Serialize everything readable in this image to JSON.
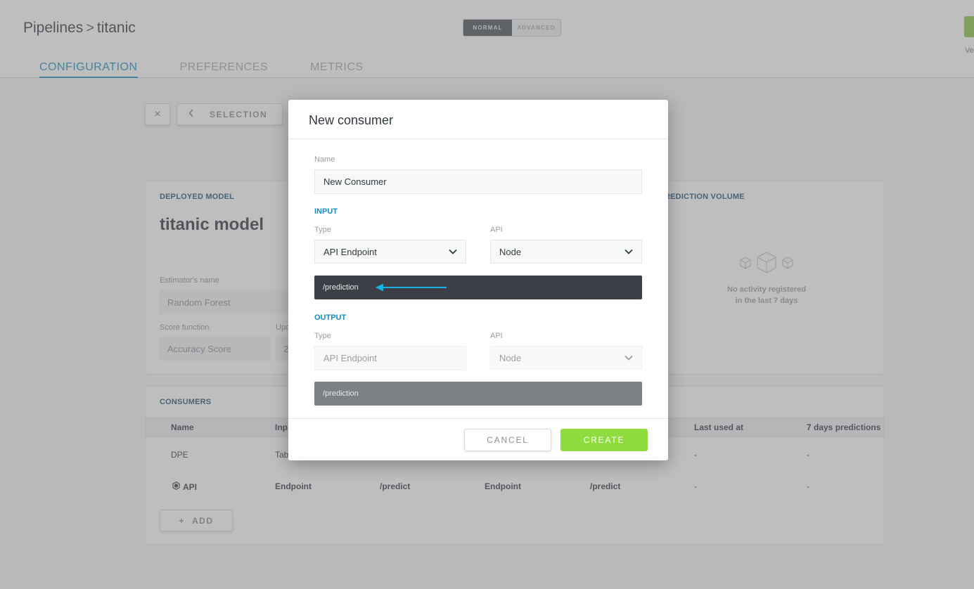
{
  "header": {
    "breadcrumb_root": "Pipelines",
    "breadcrumb_sep": ">",
    "breadcrumb_current": "titanic",
    "mode_normal": "NORMAL",
    "mode_advanced": "ADVANCED",
    "right_text": "Ve"
  },
  "tabs": [
    {
      "label": "CONFIGURATION",
      "active": true
    },
    {
      "label": "PREFERENCES",
      "active": false
    },
    {
      "label": "METRICS",
      "active": false
    }
  ],
  "toolbar": {
    "close_icon": "×",
    "back_icon": "‹",
    "selection_label": "SELECTION"
  },
  "deployed_model": {
    "section_title": "DEPLOYED MODEL",
    "model_name": "titanic model",
    "estimator_label": "Estimator's name",
    "estimator_value": "Random Forest",
    "score_label": "Score function",
    "score_value": "Accuracy Score",
    "updated_label": "Upd",
    "updated_value": "2"
  },
  "prediction_volume": {
    "section_title": "REDICTION VOLUME",
    "empty_line1": "No activity registered",
    "empty_line2": "in the last 7 days"
  },
  "consumers": {
    "section_title": "CONSUMERS",
    "columns": {
      "name": "Name",
      "input": "Inp",
      "last_used": "Last used at",
      "predictions": "7 days predictions"
    },
    "rows": [
      {
        "name": "DPE",
        "input": "Tab",
        "input_path": "",
        "output": "",
        "output_path": "",
        "last_used": "-",
        "predictions": "-"
      },
      {
        "name": "API",
        "input": "Endpoint",
        "input_path": "/predict",
        "output": "Endpoint",
        "output_path": "/predict",
        "last_used": "-",
        "predictions": "-"
      }
    ],
    "add_label": "ADD",
    "add_icon": "+"
  },
  "modal": {
    "title": "New consumer",
    "name_label": "Name",
    "name_value": "New Consumer",
    "input_section": "INPUT",
    "input_type_label": "Type",
    "input_type_value": "API Endpoint",
    "input_api_label": "API",
    "input_api_value": "Node",
    "input_path": "/prediction",
    "output_section": "OUTPUT",
    "output_type_label": "Type",
    "output_type_value": "API Endpoint",
    "output_api_label": "API",
    "output_api_value": "Node",
    "output_path": "/prediction",
    "cancel_label": "CANCEL",
    "create_label": "CREATE"
  },
  "colors": {
    "accent": "#1a8cbc",
    "create": "#8fdc3e",
    "arrow": "#1ab3e8",
    "dark_bar": "#3c4046"
  }
}
